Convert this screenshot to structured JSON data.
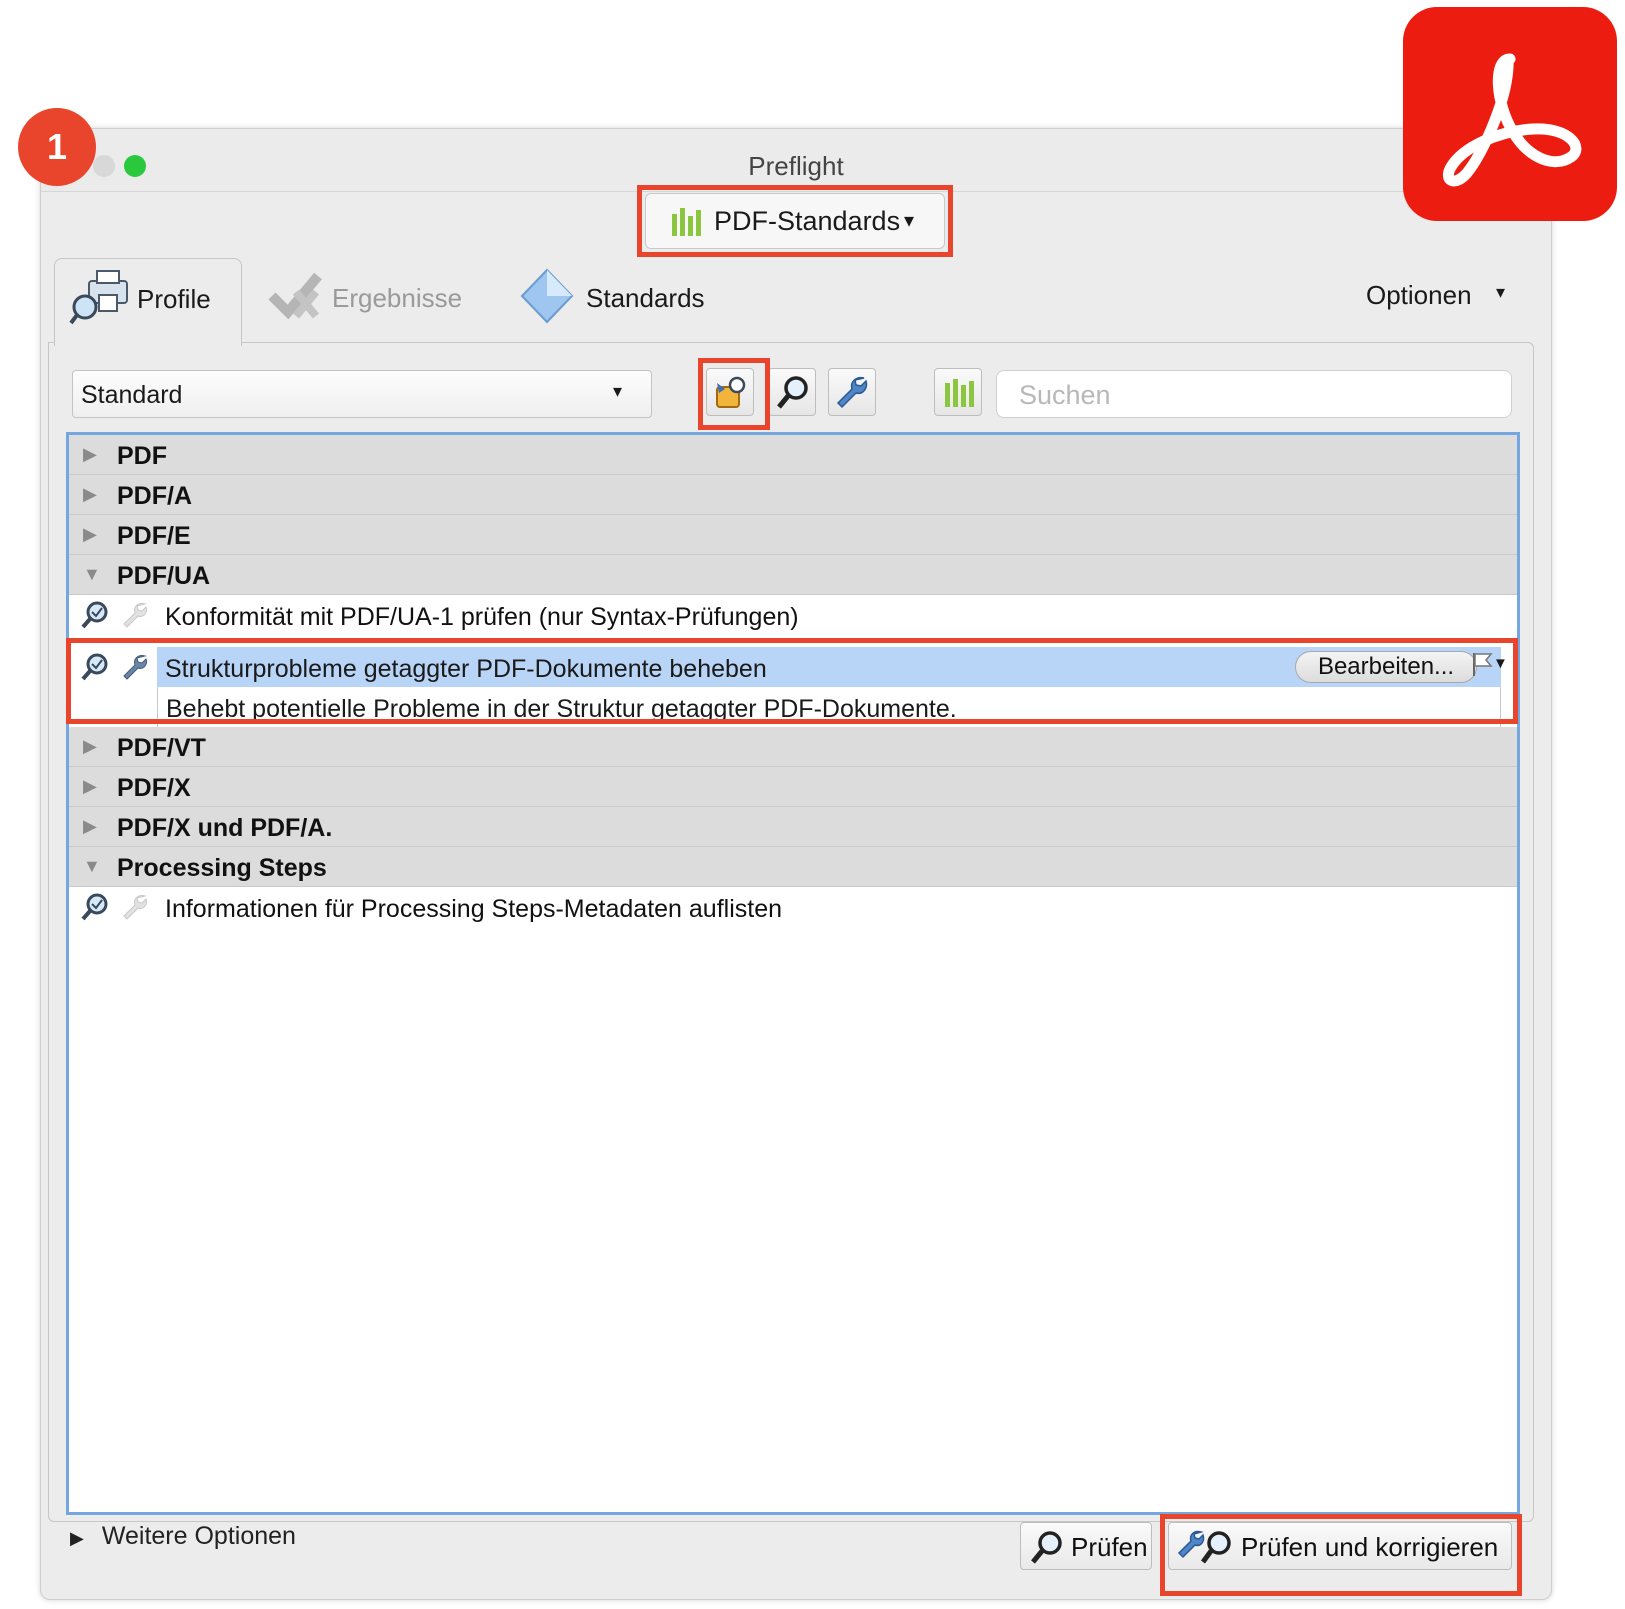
{
  "step_badge": "1",
  "window": {
    "title": "Preflight"
  },
  "standards_dropdown": {
    "label": "PDF-Standards"
  },
  "tabs": [
    {
      "label": "Profile",
      "icon": "printer-magnifier-icon",
      "active": true
    },
    {
      "label": "Ergebnisse",
      "icon": "checkmark-results-icon",
      "active": false
    },
    {
      "label": "Standards",
      "icon": "diamond-icon",
      "active": false
    }
  ],
  "options_menu": {
    "label": "Optionen"
  },
  "toolbar": {
    "profile_select_value": "Standard",
    "search_placeholder": "Suchen"
  },
  "tree": {
    "groups": [
      {
        "label": "PDF",
        "expanded": false
      },
      {
        "label": "PDF/A",
        "expanded": false
      },
      {
        "label": "PDF/E",
        "expanded": false
      },
      {
        "label": "PDF/UA",
        "expanded": true
      },
      {
        "label": "PDF/VT",
        "expanded": false
      },
      {
        "label": "PDF/X",
        "expanded": false
      },
      {
        "label": "PDF/X und PDF/A.",
        "expanded": false
      },
      {
        "label": "Processing Steps",
        "expanded": true
      }
    ],
    "rules": {
      "ua_check": "Konformität mit PDF/UA-1 prüfen (nur Syntax-Prüfungen)",
      "ua_fix": "Strukturprobleme getaggter PDF-Dokumente beheben",
      "ua_fix_desc": "Behebt potentielle Probleme in der Struktur getaggter PDF-Dokumente.",
      "ps_list": "Informationen für Processing Steps-Metadaten auflisten"
    },
    "edit_button": "Bearbeiten..."
  },
  "footer": {
    "more_options": "Weitere Optionen",
    "check_button": "Prüfen",
    "check_fix_button": "Prüfen und korrigieren"
  },
  "colors": {
    "highlight": "#e8452c",
    "selection": "#b8d4f7",
    "acrobat_red": "#ed1c10",
    "accent_green": "#8cc63f"
  }
}
